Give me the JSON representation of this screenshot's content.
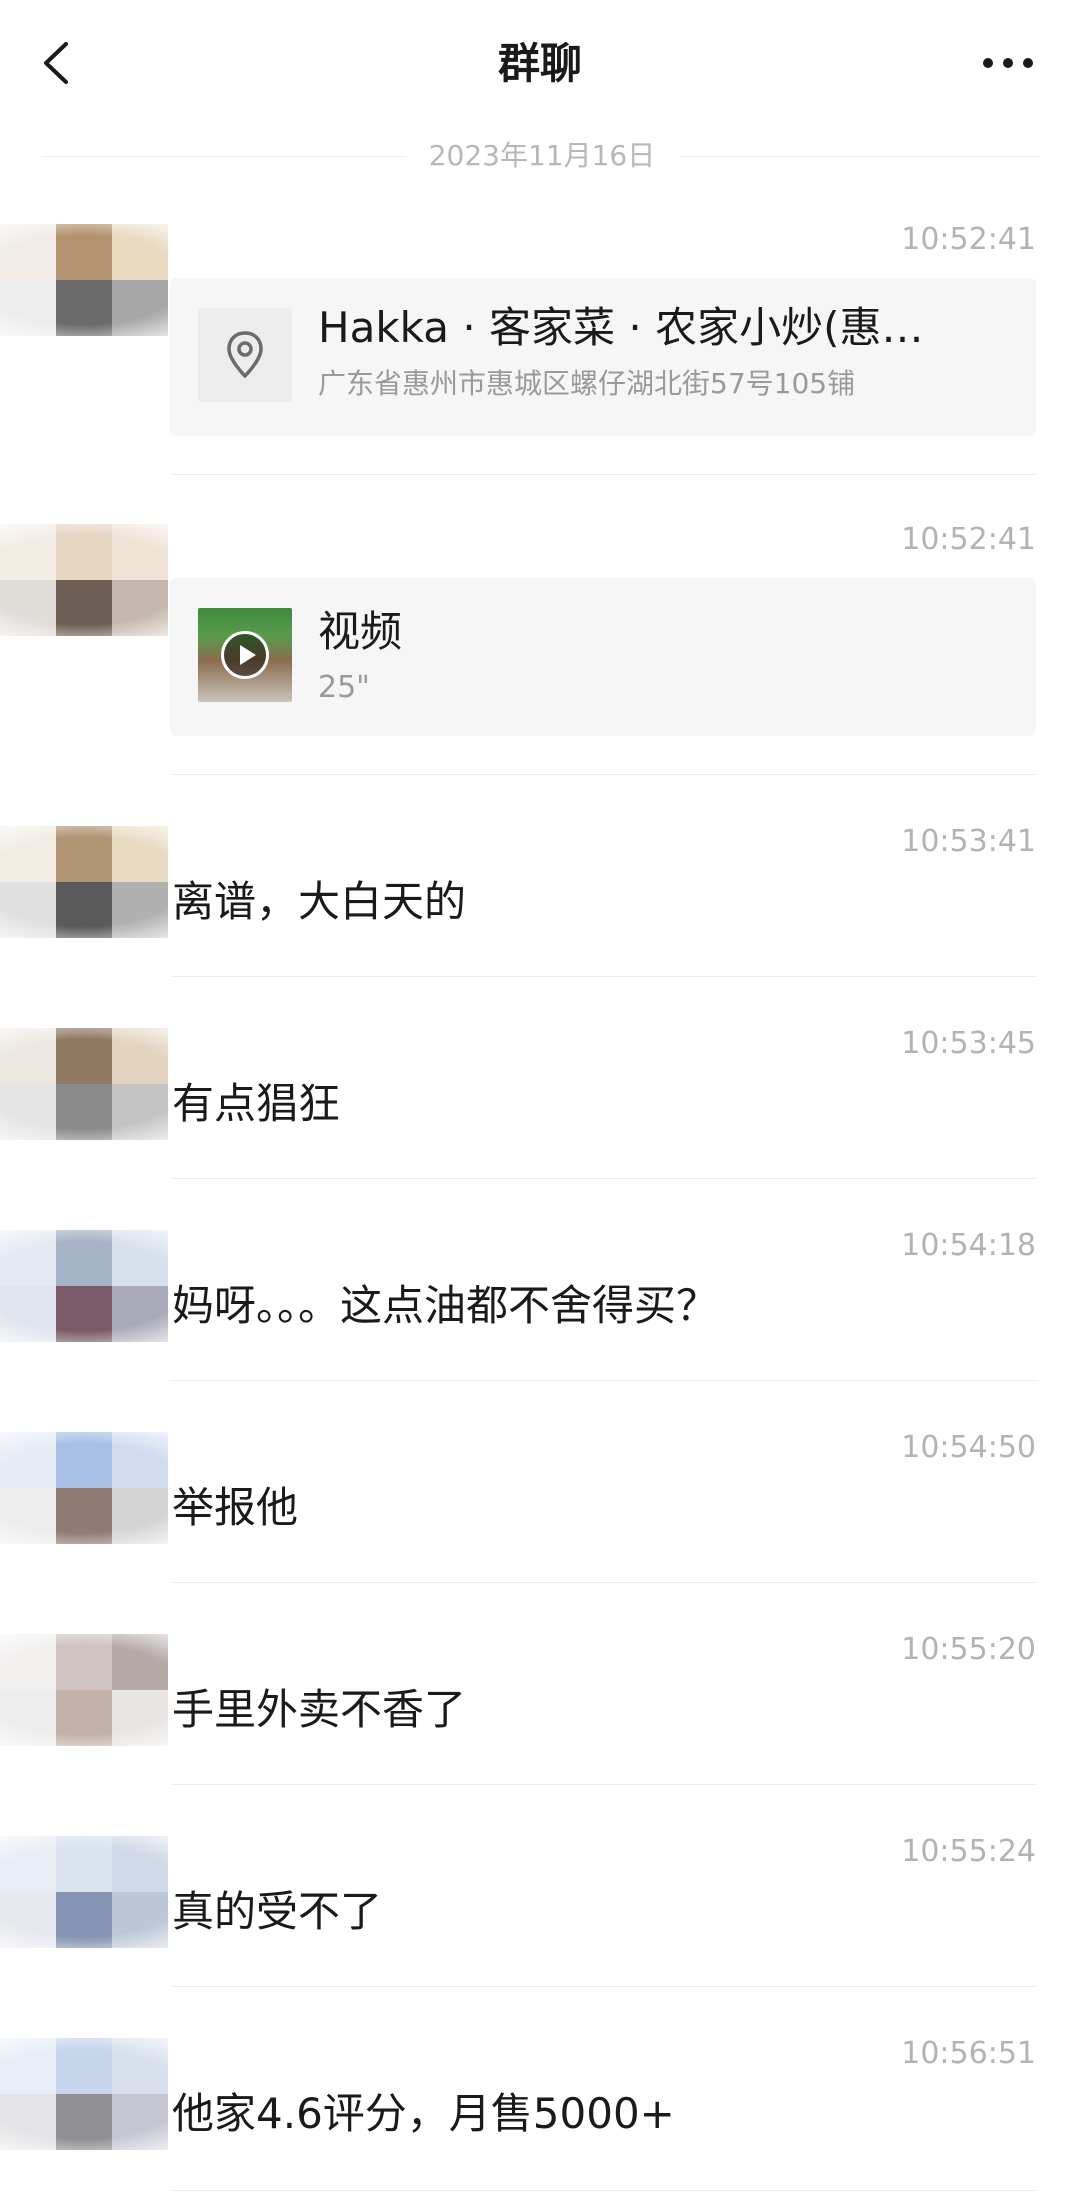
{
  "header": {
    "title": "群聊"
  },
  "date_divider": "2023年11月16日",
  "messages": [
    {
      "type": "location",
      "time": "10:52:41",
      "title": "Hakka · 客家菜 · 农家小炒(惠…",
      "address": "广东省惠州市惠城区螺仔湖北街57号105铺",
      "icon": "location-pin-icon",
      "avatar_colors": [
        "#f0ebe6",
        "#b3936f",
        "#e8d9bf",
        "#ececec",
        "#6b6b6b",
        "#a6a6a6"
      ]
    },
    {
      "type": "video",
      "time": "10:52:41",
      "title": "视频",
      "duration": "25\"",
      "icon": "play-icon",
      "avatar_colors": [
        "#f3ece4",
        "#e6d5c1",
        "#eee3d5",
        "#e0dcd8",
        "#6e5f54",
        "#c4b8ad"
      ]
    },
    {
      "type": "text",
      "time": "10:53:41",
      "text": "离谱，大白天的",
      "avatar_colors": [
        "#f2ebe4",
        "#b19474",
        "#e7dac0",
        "#e0e0e0",
        "#5a5a5a",
        "#b0b0b0"
      ]
    },
    {
      "type": "text",
      "time": "10:53:45",
      "text": "有点猖狂",
      "avatar_colors": [
        "#ede7e1",
        "#8f7a61",
        "#e2d4bf",
        "#e4e4e4",
        "#8a8a8a",
        "#c3c3c3"
      ]
    },
    {
      "type": "text",
      "time": "10:54:18",
      "text": "妈呀。。。这点油都不舍得买？",
      "avatar_colors": [
        "#e4eaf2",
        "#a4b3c6",
        "#d7e0ec",
        "#dfe4ec",
        "#7a5a66",
        "#a9a9b8"
      ]
    },
    {
      "type": "text",
      "time": "10:54:50",
      "text": "举报他",
      "avatar_colors": [
        "#e6ecf5",
        "#a8c0e6",
        "#cfdcf0",
        "#ececec",
        "#8f7a74",
        "#d4d4d4"
      ]
    },
    {
      "type": "text",
      "time": "10:55:20",
      "text": "手里外卖不香了",
      "avatar_colors": [
        "#f2f0ef",
        "#cfc4c2",
        "#b3a9a7",
        "#ededed",
        "#c3b2a9",
        "#e8e4e2"
      ]
    },
    {
      "type": "text",
      "time": "10:55:24",
      "text": "真的受不了",
      "avatar_colors": [
        "#e8edf5",
        "#d9e2ee",
        "#cfd8e6",
        "#e6e8ee",
        "#8594b3",
        "#bdc6d6"
      ]
    },
    {
      "type": "text",
      "time": "10:56:51",
      "text": "他家4.6评分，月售5000+",
      "avatar_colors": [
        "#e7edf6",
        "#c7d5ec",
        "#d8e0ee",
        "#e3e3e6",
        "#8f8f93",
        "#c6c6d2"
      ]
    }
  ]
}
